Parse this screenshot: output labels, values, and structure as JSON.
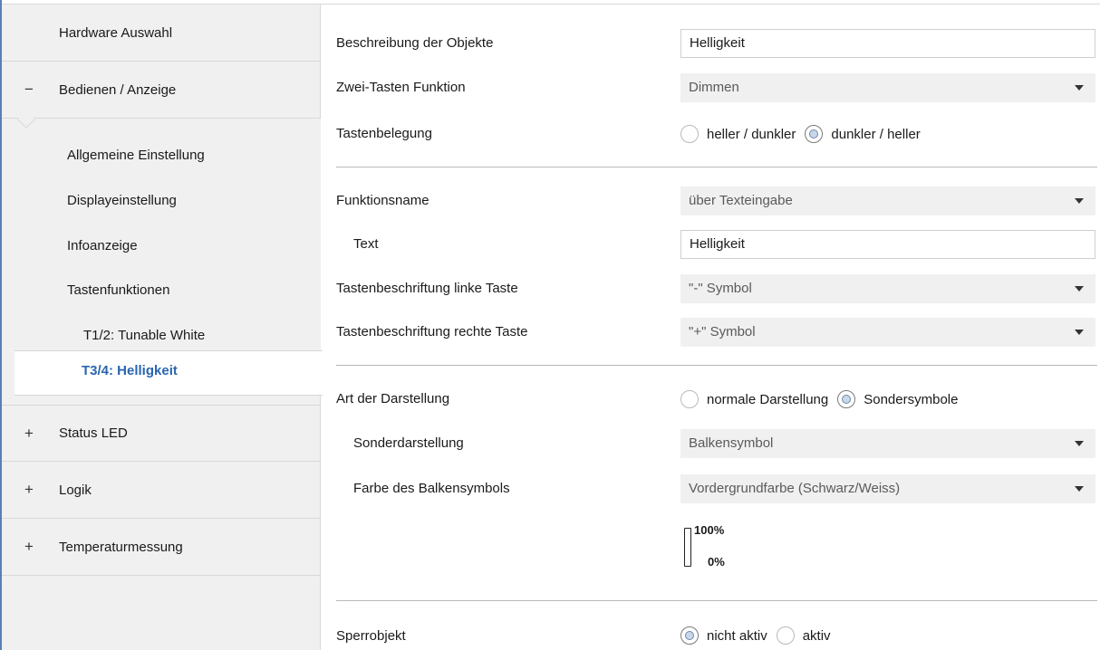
{
  "sidebar": {
    "items": [
      {
        "label": "Hardware Auswahl",
        "toggle": ""
      },
      {
        "label": "Bedienen / Anzeige",
        "toggle": "−"
      },
      {
        "label": "Status LED",
        "toggle": "+"
      },
      {
        "label": "Logik",
        "toggle": "+"
      },
      {
        "label": "Temperaturmessung",
        "toggle": "+"
      }
    ],
    "sub_items": [
      {
        "label": "Allgemeine Einstellung"
      },
      {
        "label": "Displayeinstellung"
      },
      {
        "label": "Infoanzeige"
      },
      {
        "label": "Tastenfunktionen"
      },
      {
        "label": "T1/2: Tunable White"
      }
    ],
    "selected_label": "T3/4: Helligkeit"
  },
  "form": {
    "beschreibung": {
      "label": "Beschreibung der Objekte",
      "value": "Helligkeit"
    },
    "zwei_tasten": {
      "label": "Zwei-Tasten Funktion",
      "value": "Dimmen"
    },
    "tastenbelegung": {
      "label": "Tastenbelegung",
      "option1": "heller / dunkler",
      "option2": "dunkler / heller",
      "selected": "dunkler / heller"
    },
    "funktionsname": {
      "label": "Funktionsname",
      "value": "über Texteingabe"
    },
    "text": {
      "label": "Text",
      "value": "Helligkeit"
    },
    "links": {
      "label": "Tastenbeschriftung linke Taste",
      "value": "\"-\" Symbol"
    },
    "rechts": {
      "label": "Tastenbeschriftung rechte Taste",
      "value": "\"+\" Symbol"
    },
    "darstellung": {
      "label": "Art der Darstellung",
      "option1": "normale Darstellung",
      "option2": "Sondersymbole",
      "selected": "Sondersymbole"
    },
    "sonderdarstellung": {
      "label": "Sonderdarstellung",
      "value": "Balkensymbol"
    },
    "farbe": {
      "label": "Farbe des Balkensymbols",
      "value": "Vordergrundfarbe (Schwarz/Weiss)"
    },
    "bar_preview": {
      "top_label": "100%",
      "bottom_label": "0%"
    },
    "sperrobjekt": {
      "label": "Sperrobjekt",
      "option1": "nicht aktiv",
      "option2": "aktiv",
      "selected": "nicht aktiv"
    }
  },
  "colors": {
    "accent": "#2a65b0",
    "frame": "#5b7fb3",
    "sidebar_bg": "#f0f0f0"
  }
}
